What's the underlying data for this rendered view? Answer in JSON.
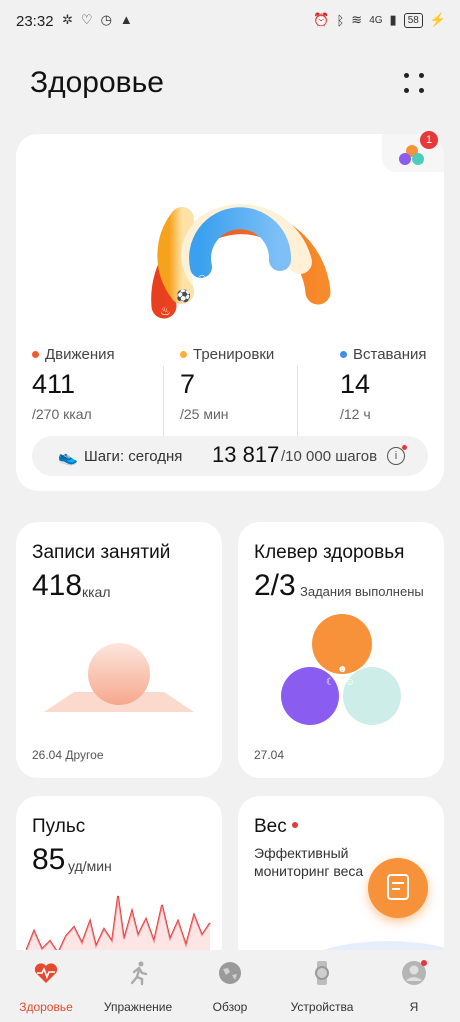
{
  "status_bar": {
    "time": "23:32",
    "network": "4G",
    "battery": "58"
  },
  "header": {
    "title": "Здоровье"
  },
  "rings": {
    "badge_count": "1",
    "move": {
      "label": "Движения",
      "value": "411",
      "goal": "/270 ккал",
      "color": "#f05a28"
    },
    "exercise": {
      "label": "Тренировки",
      "value": "7",
      "goal": "/25 мин",
      "color": "#fbb03b"
    },
    "stand": {
      "label": "Вставания",
      "value": "14",
      "goal": "/12 ч",
      "color": "#3d8ef0"
    },
    "steps": {
      "label": "Шаги: сегодня",
      "value": "13 817",
      "goal": "/10 000 шагов",
      "info_icon": "info-icon"
    }
  },
  "workouts_card": {
    "title": "Записи занятий",
    "value": "418",
    "unit": "ккал",
    "date": "26.04 Другое"
  },
  "clover_card": {
    "title": "Клевер здоровья",
    "value": "2/3",
    "unit": "Задания выполнены",
    "date": "27.04",
    "colors": {
      "top": "#f7923a",
      "left": "#8a5cf0",
      "right": "#cdeee8"
    }
  },
  "pulse_card": {
    "title": "Пульс",
    "value": "85",
    "unit": "уд/мин"
  },
  "weight_card": {
    "title": "Вес",
    "description_line1": "Эффективный",
    "description_line2": "мониторинг веса"
  },
  "tabs": [
    {
      "label": "Здоровье",
      "icon": "heart-pulse-icon",
      "active": true
    },
    {
      "label": "Упражнение",
      "icon": "running-icon",
      "active": false
    },
    {
      "label": "Обзор",
      "icon": "globe-icon",
      "active": false
    },
    {
      "label": "Устройства",
      "icon": "watch-icon",
      "active": false
    },
    {
      "label": "Я",
      "icon": "profile-icon",
      "active": false
    }
  ],
  "colors": {
    "accent": "#e64a2e",
    "fab": "#f7923a"
  }
}
